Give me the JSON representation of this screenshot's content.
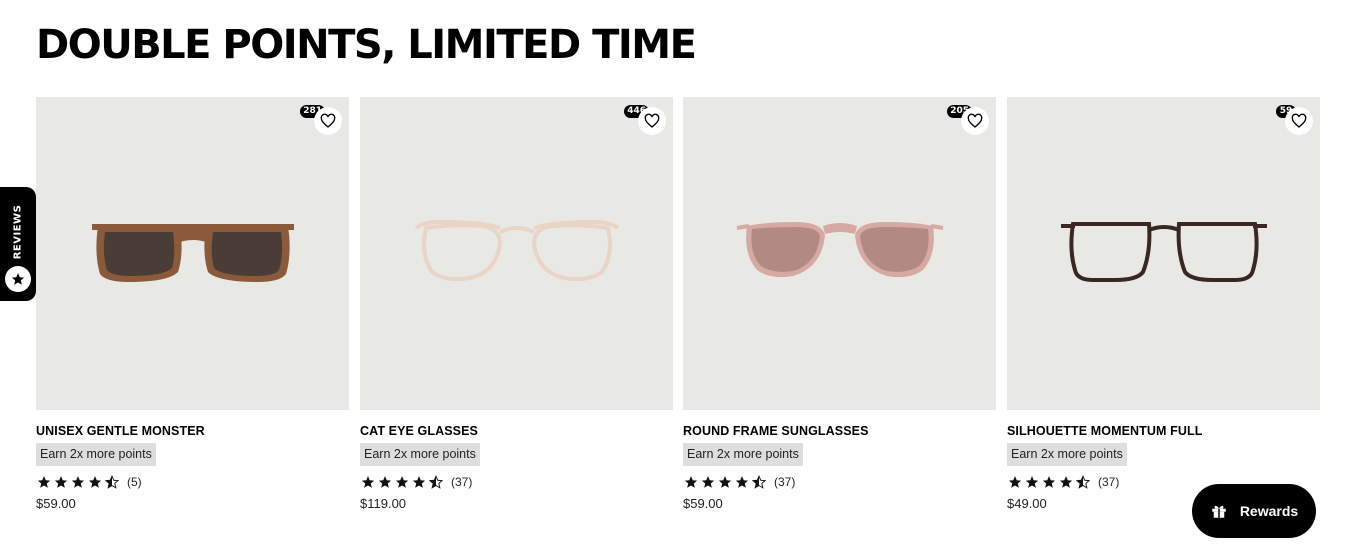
{
  "section": {
    "title": "DOUBLE POINTS, LIMITED TIME"
  },
  "products": [
    {
      "name": "UNISEX GENTLE MONSTER",
      "badge": "Earn 2x more points",
      "rating": 4.5,
      "reviews": "(5)",
      "price": "$59.00",
      "wishlist_count": "281",
      "frame_color": "#8a5a3a",
      "lens_color": "#4a3d37",
      "style": "square-sunglasses"
    },
    {
      "name": "CAT EYE GLASSES",
      "badge": "Earn 2x more points",
      "rating": 4.5,
      "reviews": "(37)",
      "price": "$119.00",
      "wishlist_count": "446",
      "frame_color": "#ead4c6",
      "lens_color": "none",
      "style": "round-optical"
    },
    {
      "name": "ROUND FRAME SUNGLASSES",
      "badge": "Earn 2x more points",
      "rating": 4.5,
      "reviews": "(37)",
      "price": "$59.00",
      "wishlist_count": "205",
      "frame_color": "#d6a9a3",
      "lens_color": "#b38a83",
      "style": "aviator-sunglasses"
    },
    {
      "name": "SILHOUETTE MOMENTUM FULL",
      "badge": "Earn 2x more points",
      "rating": 4.5,
      "reviews": "(37)",
      "price": "$49.00",
      "wishlist_count": "59",
      "frame_color": "#3a2622",
      "lens_color": "none",
      "style": "square-optical"
    }
  ],
  "reviews_tab": {
    "label": "REVIEWS"
  },
  "rewards": {
    "label": "Rewards"
  }
}
